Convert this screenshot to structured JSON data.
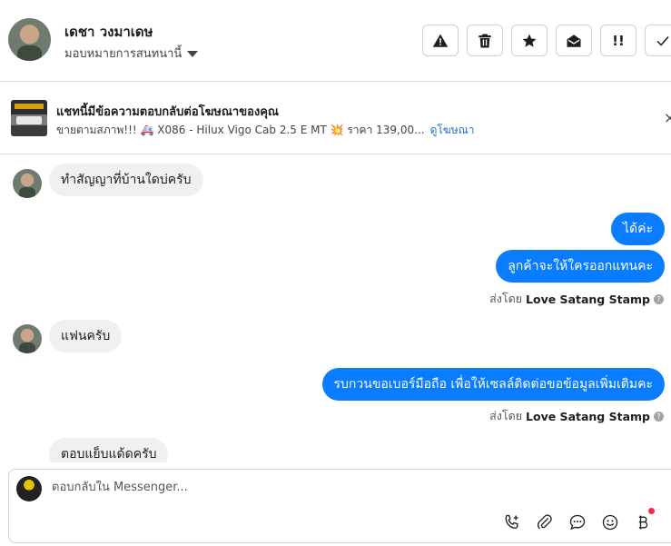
{
  "header": {
    "contact_name": "เดชา วงมาเดษ",
    "assign_label": "มอบหมายการสนทนานี้",
    "toolbar": [
      {
        "name": "report-button",
        "icon": "warning-icon"
      },
      {
        "name": "delete-button",
        "icon": "trash-icon"
      },
      {
        "name": "star-button",
        "icon": "star-icon"
      },
      {
        "name": "mark-unread-button",
        "icon": "envelope-open-icon"
      },
      {
        "name": "priority-button",
        "icon": "exclamation-icon",
        "text": "!!"
      },
      {
        "name": "done-button",
        "icon": "check-icon"
      }
    ]
  },
  "ad": {
    "title": "แชทนี้มีข้อความตอบกลับต่อโฆษณาของคุณ",
    "description": "ขายตามสภาพ!!! 🚑 X086 - Hilux Vigo Cab 2.5 E MT 💥 ราคา 139,00...",
    "link": "ดูโฆษณา",
    "close": "×"
  },
  "messages": [
    {
      "dir": "in",
      "text": "ทำสัญญาที่บ้านใดบ่ครับ"
    },
    {
      "dir": "out",
      "text": "ได้ค่ะ"
    },
    {
      "dir": "out",
      "text": "ลูกค้าจะให้ใครออกแทนคะ"
    },
    {
      "dir": "sentby",
      "prefix": "ส่งโดย",
      "sender": "Love Satang Stamp"
    },
    {
      "dir": "in",
      "text": "แฟนครับ"
    },
    {
      "dir": "out",
      "text": "รบกวนขอเบอร์มือถือ เพื่อให้เซลล์ติดต่อขอข้อมูลเพิ่มเติมคะ"
    },
    {
      "dir": "sentby",
      "prefix": "ส่งโดย",
      "sender": "Love Satang Stamp"
    },
    {
      "dir": "in",
      "text": "ตอบแย็บแด้ดครับ"
    }
  ],
  "composer": {
    "placeholder": "ตอบกลับใน Messenger...",
    "icons": [
      "phone-add-icon",
      "paperclip-icon",
      "chat-bubble-icon",
      "emoji-icon",
      "baht-icon"
    ]
  },
  "colors": {
    "accent": "#0a7cff",
    "incoming_bubble": "#f0f0f0",
    "link": "#216fdb",
    "notification": "#f02849"
  }
}
